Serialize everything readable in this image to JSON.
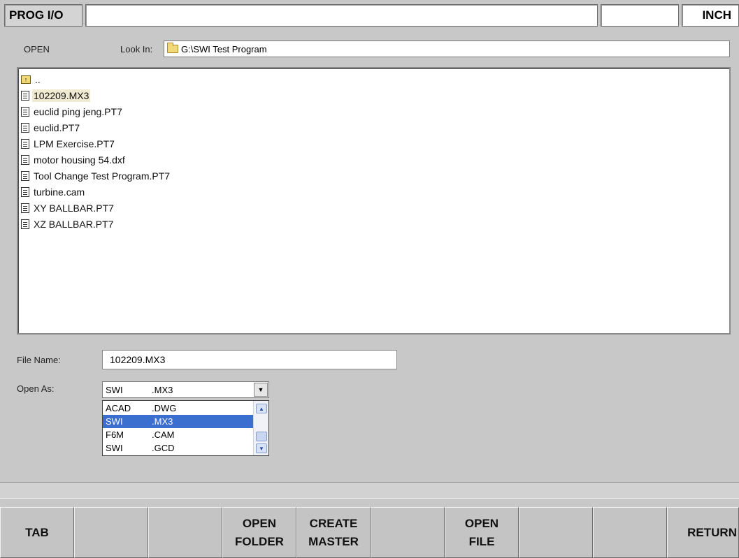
{
  "topbar": {
    "mode": "PROG I/O",
    "message": "",
    "blank": "",
    "units": "INCH"
  },
  "open": {
    "title": "OPEN",
    "look_in_label": "Look In:",
    "look_in_path": "G:\\SWI Test Program",
    "look_in_icon": "folder-icon"
  },
  "files": [
    {
      "name": "..",
      "icon": "up-folder-icon"
    },
    {
      "name": "102209.MX3",
      "icon": "document-icon",
      "selected": true
    },
    {
      "name": "euclid ping jeng.PT7",
      "icon": "document-icon"
    },
    {
      "name": "euclid.PT7",
      "icon": "document-icon"
    },
    {
      "name": "LPM Exercise.PT7",
      "icon": "document-icon"
    },
    {
      "name": "motor housing 54.dxf",
      "icon": "document-icon"
    },
    {
      "name": "Tool Change Test Program.PT7",
      "icon": "document-icon"
    },
    {
      "name": "turbine.cam",
      "icon": "document-icon"
    },
    {
      "name": "XY BALLBAR.PT7",
      "icon": "document-icon"
    },
    {
      "name": "XZ BALLBAR.PT7",
      "icon": "document-icon"
    }
  ],
  "filename": {
    "label": "File Name:",
    "value": "102209.MX3"
  },
  "open_as": {
    "label": "Open As:",
    "selected": {
      "type": "SWI",
      "ext": ".MX3"
    },
    "options": [
      {
        "type": "ACAD",
        "ext": ".DWG"
      },
      {
        "type": "SWI",
        "ext": ".MX3",
        "highlighted": true
      },
      {
        "type": "F6M",
        "ext": ".CAM"
      },
      {
        "type": "SWI",
        "ext": ".GCD"
      }
    ],
    "highlight_color": "#3a6fd0"
  },
  "softkeys": [
    "TAB",
    "",
    "",
    "OPEN\nFOLDER",
    "CREATE\nMASTER",
    "",
    "OPEN\nFILE",
    "",
    "",
    "RETURN"
  ]
}
